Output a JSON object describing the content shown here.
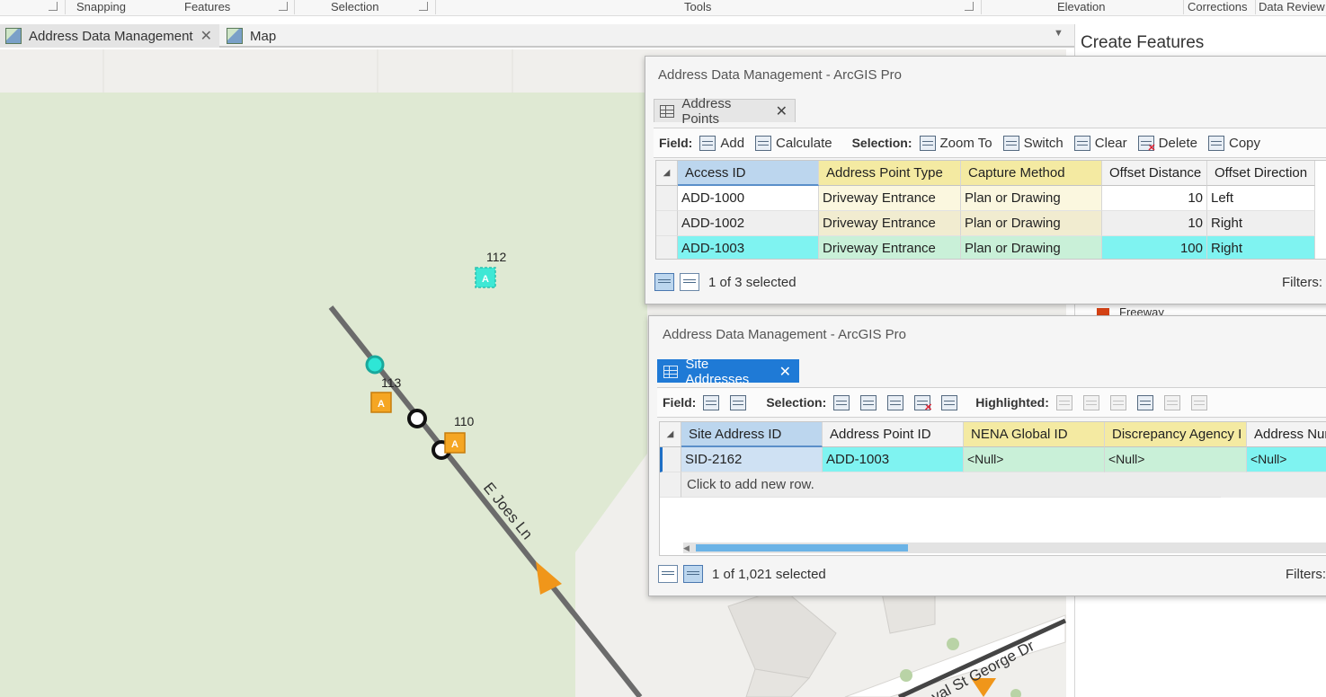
{
  "ribbon": {
    "groups": [
      "Snapping",
      "Features",
      "Selection",
      "Tools",
      "Elevation",
      "Corrections",
      "Data Review"
    ]
  },
  "view_tabs": [
    {
      "label": "Address Data Management",
      "active": true
    },
    {
      "label": "Map",
      "active": false
    }
  ],
  "map": {
    "labels": {
      "p112": "112",
      "p113": "113",
      "p110": "110",
      "street1": "E Joes Ln",
      "street2": "val St George Dr"
    },
    "marker_glyph": "A",
    "colors": {
      "park": "#dfe9d3",
      "road": "#6b6b6b",
      "arrow": "#f0961a",
      "point_orange": "#f5a623",
      "point_cyan": "#2ee6d6"
    }
  },
  "create_features": {
    "title": "Create Features",
    "legend_item": "Freeway",
    "legend_color": "#d84315"
  },
  "window1": {
    "title": "Address Data Management - ArcGIS Pro",
    "tab_label": "Address Points",
    "field_label": "Field:",
    "field_buttons": [
      "Add",
      "Calculate"
    ],
    "selection_label": "Selection:",
    "selection_buttons": [
      "Zoom To",
      "Switch",
      "Clear",
      "Delete",
      "Copy"
    ],
    "columns": [
      "Access ID",
      "Address Point Type",
      "Capture Method",
      "Offset Distance",
      "Offset Direction"
    ],
    "rows": [
      {
        "c0": "ADD-1000",
        "c1": "Driveway Entrance",
        "c2": "Plan or Drawing",
        "c3": "10",
        "c4": "Left"
      },
      {
        "c0": "ADD-1002",
        "c1": "Driveway Entrance",
        "c2": "Plan or Drawing",
        "c3": "10",
        "c4": "Right"
      },
      {
        "c0": "ADD-1003",
        "c1": "Driveway Entrance",
        "c2": "Plan or Drawing",
        "c3": "100",
        "c4": "Right"
      }
    ],
    "status": "1 of 3 selected",
    "filters": "Filters:"
  },
  "window2": {
    "title": "Address Data Management - ArcGIS Pro",
    "tab_label": "Site Addresses",
    "field_label": "Field:",
    "selection_label": "Selection:",
    "highlighted_label": "Highlighted:",
    "columns": [
      "Site Address ID",
      "Address Point ID",
      "NENA Global ID",
      "Discrepancy Agency I",
      "Address Nur"
    ],
    "row": {
      "c0": "SID-2162",
      "c1": "ADD-1003",
      "c2": "<Null>",
      "c3": "<Null>",
      "c4": "<Null>"
    },
    "add_row": "Click to add new row.",
    "status": "1 of 1,021 selected",
    "filters": "Filters:"
  }
}
